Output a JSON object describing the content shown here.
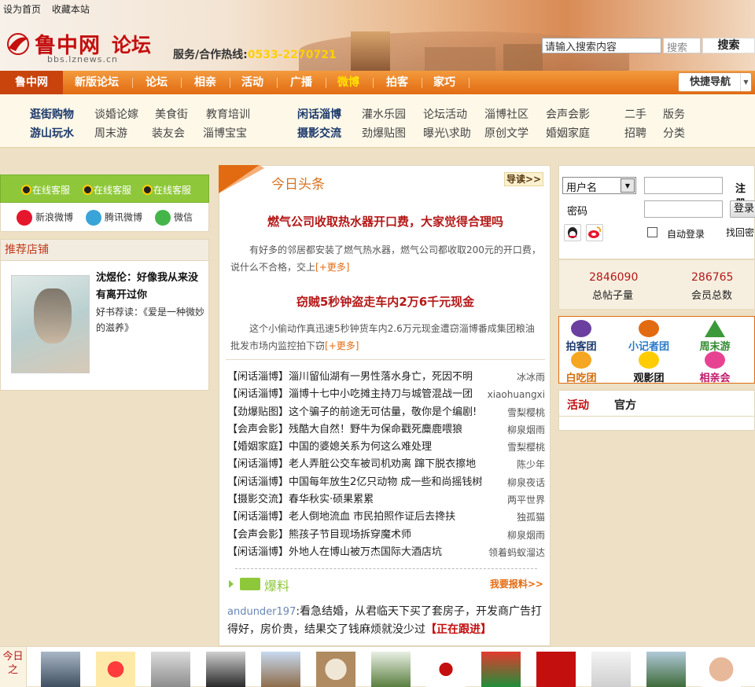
{
  "header": {
    "top_links": [
      "设为首页",
      "收藏本站"
    ],
    "logo_name": "鲁中网",
    "logo_sub": "论坛",
    "logo_url": "bbs.lznews.cn",
    "hotline_label": "服务/合作热线:",
    "hotline_number": "0533-2270721",
    "search_placeholder": "请输入搜索内容",
    "search_select": "搜索",
    "search_button": "搜索"
  },
  "nav": {
    "items": [
      "鲁中网",
      "新版论坛",
      "论坛",
      "相亲",
      "活动",
      "广播",
      "微博",
      "拍客",
      "家巧"
    ],
    "quick_nav": "快捷导航"
  },
  "subnav": {
    "row1": [
      "逛街购物",
      "谈婚论嫁",
      "美食街",
      "教育培训",
      "闲话淄博",
      "灌水乐园",
      "论坛活动",
      "淄博社区",
      "会声会影",
      "二手",
      "版务"
    ],
    "row2": [
      "游山玩水",
      "周末游",
      "装友会",
      "淄博宝宝",
      "摄影交流",
      "劲爆贴图",
      "曝光\\求助",
      "原创文学",
      "婚姻家庭",
      "招聘",
      "分类"
    ]
  },
  "left": {
    "service": [
      "在线客服",
      "在线客服",
      "在线客服"
    ],
    "weibo": [
      "新浪微博",
      "腾讯微博",
      "微信"
    ],
    "recommend_title": "推荐店铺",
    "book_title": "沈煜伦：好像我从来没有离开过你",
    "book_desc": "好书荐读：《爱是一种微妙的滋养》"
  },
  "center": {
    "section_title": "今日头条",
    "guide": "导读>>",
    "headline1": "燃气公司收取热水器开口费，大家觉得合理吗",
    "summary1": "有好多的邻居都安装了燃气热水器，燃气公司都收取200元的开口费，说什么不合格，交上",
    "more": "[+更多]",
    "headline2": "窃贼5秒钟盗走车内2万6千元现金",
    "summary2": "这个小偷动作真迅速5秒钟货车内2.6万元现金遭窃淄博番成集团粮油批发市场内监控拍下窃",
    "news": [
      {
        "cat": "【闲话淄博】",
        "title": "淄川留仙湖有一男性落水身亡，死因不明",
        "author": "冰冰雨"
      },
      {
        "cat": "【闲话淄博】",
        "title": "淄博十七中小吃摊主持刀与城管混战一团",
        "author": "xiaohuangxi"
      },
      {
        "cat": "【劲爆贴图】",
        "title": "这个骗子的前途无可估量，敬你是个编剧!",
        "author": "雪梨樱桃"
      },
      {
        "cat": "【会声会影】",
        "title": "残酷大自然！野牛为保命戳死麋鹿喂狼",
        "author": "柳泉烟雨"
      },
      {
        "cat": "【婚姻家庭】",
        "title": "中国的婆媳关系为何这么难处理",
        "author": "雪梨樱桃"
      },
      {
        "cat": "【闲话淄博】",
        "title": "老人弄脏公交车被司机劝离 蹿下脱衣擦地",
        "author": "陈少年"
      },
      {
        "cat": "【闲话淄博】",
        "title": "中国每年放生2亿只动物 成一些和尚摇钱树",
        "author": "柳泉夜话"
      },
      {
        "cat": "【摄影交流】",
        "title": "春华秋实·硕果累累",
        "author": "两平世界"
      },
      {
        "cat": "【闲话淄博】",
        "title": "老人倒地流血 市民拍照作证后去搀扶",
        "author": "独孤猫"
      },
      {
        "cat": "【会声会影】",
        "title": "熊孩子节目现场拆穿魔术师",
        "author": "柳泉烟雨"
      },
      {
        "cat": "【闲话淄博】",
        "title": "外地人在博山被万杰国际大酒店坑",
        "author": "领着蚂蚁溜达"
      }
    ],
    "baoliao_title": "爆料",
    "baoliao_more": "我要报料>>",
    "baoliao_user": "andunder197",
    "baoliao_text": ":看急结婚，从君临天下买了套房子，开发商广告打得好，房价贵，结果交了钱麻烦就没少过",
    "baoliao_follow": "【正在跟进】"
  },
  "right": {
    "username_select": "用户名",
    "register": "注册",
    "password_label": "密码",
    "login_button": "登录",
    "auto_login": "自动登录",
    "forgot": "找回密",
    "total_posts": "2846090",
    "total_posts_label": "总帖子量",
    "total_members": "286765",
    "total_members_label": "会员总数",
    "groups": [
      "拍客团",
      "小记者团",
      "周末游",
      "白吃团",
      "观影团",
      "相亲会"
    ],
    "tabs": [
      "活动",
      "官方"
    ]
  },
  "strip": {
    "label": "今日之"
  },
  "colors": {
    "nav_orange": "#e26b12",
    "headline_red": "#b41818",
    "service_green": "#8ec83a"
  }
}
